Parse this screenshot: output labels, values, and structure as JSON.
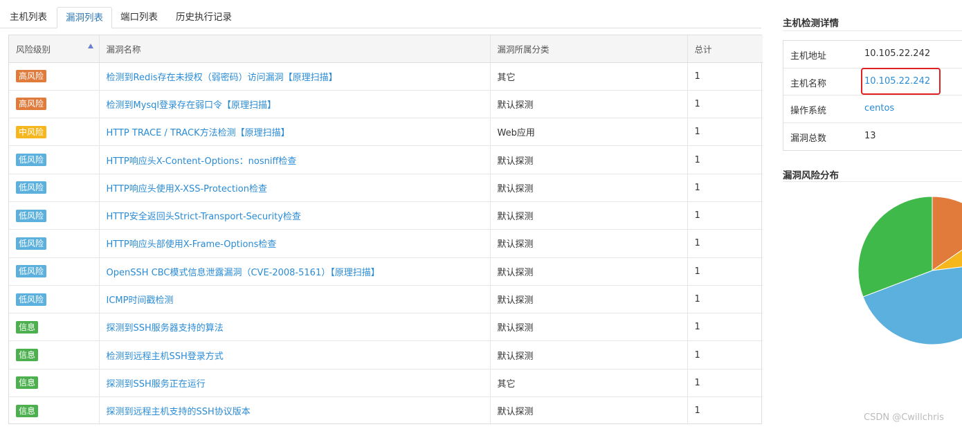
{
  "tabs": [
    {
      "label": "主机列表"
    },
    {
      "label": "漏洞列表"
    },
    {
      "label": "端口列表"
    },
    {
      "label": "历史执行记录"
    }
  ],
  "vuln_table": {
    "headers": [
      "风险级别",
      "漏洞名称",
      "漏洞所属分类",
      "总计"
    ],
    "rows": [
      {
        "level": "高风险",
        "name": "检测到Redis存在未授权（弱密码）访问漏洞【原理扫描】",
        "category": "其它",
        "total": "1"
      },
      {
        "level": "高风险",
        "name": "检测到Mysql登录存在弱口令【原理扫描】",
        "category": "默认探测",
        "total": "1"
      },
      {
        "level": "中风险",
        "name": "HTTP TRACE / TRACK方法检测【原理扫描】",
        "category": "Web应用",
        "total": "1"
      },
      {
        "level": "低风险",
        "name": "HTTP响应头X-Content-Options：nosniff检查",
        "category": "默认探测",
        "total": "1"
      },
      {
        "level": "低风险",
        "name": "HTTP响应头使用X-XSS-Protection检查",
        "category": "默认探测",
        "total": "1"
      },
      {
        "level": "低风险",
        "name": "HTTP安全返回头Strict-Transport-Security检查",
        "category": "默认探测",
        "total": "1"
      },
      {
        "level": "低风险",
        "name": "HTTP响应头部使用X-Frame-Options检查",
        "category": "默认探测",
        "total": "1"
      },
      {
        "level": "低风险",
        "name": "OpenSSH CBC模式信息泄露漏洞（CVE-2008-5161）【原理扫描】",
        "category": "默认探测",
        "total": "1"
      },
      {
        "level": "低风险",
        "name": "ICMP时间戳检测",
        "category": "默认探测",
        "total": "1"
      },
      {
        "level": "信息",
        "name": "探测到SSH服务器支持的算法",
        "category": "默认探测",
        "total": "1"
      },
      {
        "level": "信息",
        "name": "检测到远程主机SSH登录方式",
        "category": "默认探测",
        "total": "1"
      },
      {
        "level": "信息",
        "name": "探测到SSH服务正在运行",
        "category": "其它",
        "total": "1"
      },
      {
        "level": "信息",
        "name": "探测到远程主机支持的SSH协议版本",
        "category": "默认探测",
        "total": "1"
      }
    ]
  },
  "level_colors": {
    "高风险": "#e07b3c",
    "中风险": "#f5b61e",
    "低风险": "#5bb0de",
    "信息": "#4cb04e"
  },
  "detail": {
    "title": "主机检测详情",
    "rows": [
      {
        "label": "主机地址",
        "value": "10.105.22.242"
      },
      {
        "label": "主机名称",
        "value": "10.105.22.242"
      },
      {
        "label": "操作系统",
        "value": "centos"
      },
      {
        "label": "漏洞总数",
        "value": "13"
      }
    ]
  },
  "risk_distribution": {
    "title": "漏洞风险分布",
    "colors": {
      "high": "#e07b3c",
      "medium": "#f5b61e",
      "low": "#5bb0de",
      "info": "#3fba4a"
    },
    "counts": {
      "high": 2,
      "medium": 1,
      "low": 6,
      "info": 4
    }
  },
  "watermark": "CSDN @Cwillchris"
}
